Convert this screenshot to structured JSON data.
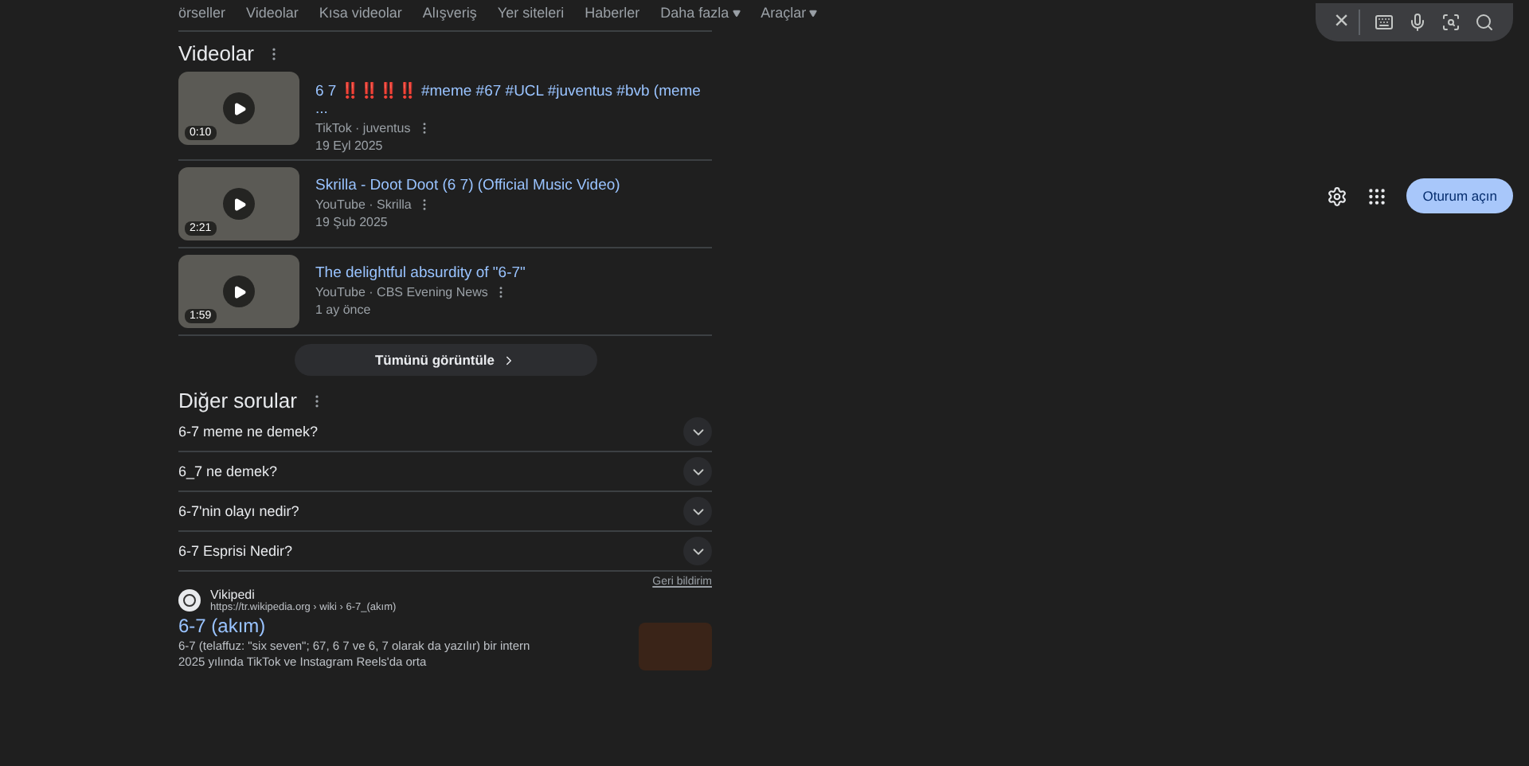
{
  "search_bar": {
    "clear": "×"
  },
  "tabs": [
    {
      "label": "örseller",
      "dropdown": false
    },
    {
      "label": "Videolar",
      "dropdown": false
    },
    {
      "label": "Kısa videolar",
      "dropdown": false
    },
    {
      "label": "Alışveriş",
      "dropdown": false
    },
    {
      "label": "Yer siteleri",
      "dropdown": false
    },
    {
      "label": "Haberler",
      "dropdown": false
    },
    {
      "label": "Daha fazla",
      "dropdown": true
    },
    {
      "label": "Araçlar",
      "dropdown": true
    }
  ],
  "header": {
    "sign_in": "Oturum açın"
  },
  "videos": {
    "title": "Videolar",
    "items": [
      {
        "title": "6 7 ‼️‼️‼️‼️ #meme #67 #UCL #juventus #bvb (meme ...",
        "source": "TikTok · juventus",
        "date": "19 Eyl 2025",
        "duration": "0:10"
      },
      {
        "title": "Skrilla - Doot Doot (6 7) (Official Music Video)",
        "source": "YouTube · Skrilla",
        "date": "19 Şub 2025",
        "duration": "2:21"
      },
      {
        "title": "The delightful absurdity of \"6-7\"",
        "source": "YouTube · CBS Evening News",
        "date": "1 ay önce",
        "duration": "1:59"
      }
    ],
    "view_all": "Tümünü görüntüle"
  },
  "questions": {
    "title": "Diğer sorular",
    "items": [
      {
        "text": "6-7 meme ne demek?",
        "expanded": false
      },
      {
        "text": "6_7 ne demek?",
        "expanded": false
      },
      {
        "text": "6-7'nin olayı nedir?",
        "expanded": false
      },
      {
        "text": "6-7 Esprisi Nedir?",
        "expanded": false
      }
    ],
    "feedback": "Geri bildirim"
  },
  "result": {
    "site": "Vikipedi",
    "url": "https://tr.wikipedia.org › wiki › 6-7_(akım)",
    "title": "6-7 (akım)",
    "snippet": [
      "6-7 (telaffuz: \"six seven\"; 67, 6 7 ve 6, 7 olarak da yazılır) bir intern",
      "2025 yılında TikTok ve Instagram Reels'da orta"
    ]
  }
}
